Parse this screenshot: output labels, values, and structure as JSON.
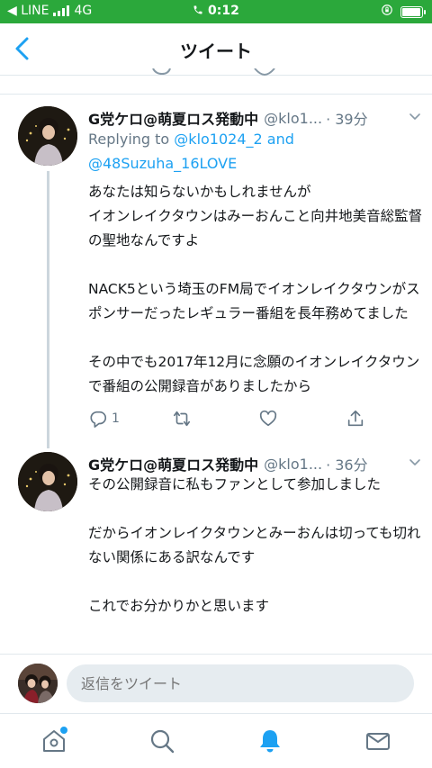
{
  "status_bar": {
    "carrier": "◀ LINE",
    "network": "4G",
    "time": "0:12"
  },
  "header": {
    "title": "ツイート"
  },
  "tweets": [
    {
      "name": "G党ケロ@萌夏ロス発動中",
      "handle": "@klo1...",
      "time": "· 39分",
      "reply_prefix": "Replying to ",
      "reply_user1": "@klo1024_2",
      "reply_and": " and",
      "reply_user2": "@48Suzuha_16LOVE",
      "text": "あなたは知らないかもしれませんが\nイオンレイクタウンはみーおんこと向井地美音総監督の聖地なんですよ\n\nNACK5という埼玉のFM局でイオンレイクタウンがスポンサーだったレギュラー番組を長年務めてました\n\nその中でも2017年12月に念願のイオンレイクタウンで番組の公開録音がありましたから",
      "reply_count": "1"
    },
    {
      "name": "G党ケロ@萌夏ロス発動中",
      "handle": "@klo1...",
      "time": "· 36分",
      "text": "その公開録音に私もファンとして参加しました\n\nだからイオンレイクタウンとみーおんは切っても切れない関係にある訳なんです\n\nこれでお分かりかと思います"
    }
  ],
  "composer": {
    "placeholder": "返信をツイート"
  },
  "tabs": [
    "home",
    "search",
    "notifications",
    "messages"
  ],
  "colors": {
    "status_bar": "#2ba83b",
    "accent": "#1da1f2",
    "secondary_text": "#657786",
    "divider": "#e1e8ed"
  },
  "icons": [
    "back-arrow-icon",
    "chevron-down-icon",
    "reply-icon",
    "retweet-icon",
    "like-icon",
    "share-icon",
    "home-icon",
    "search-icon",
    "bell-icon",
    "mail-icon"
  ]
}
